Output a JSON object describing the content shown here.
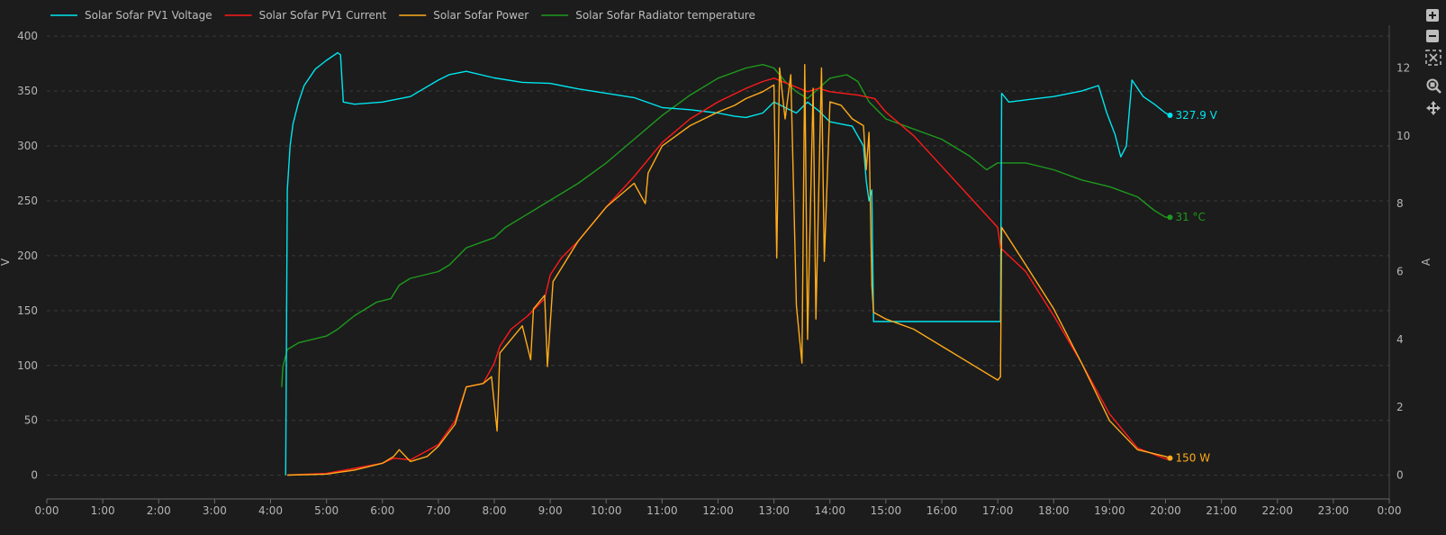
{
  "chart_data": {
    "type": "line",
    "title": "",
    "xlabel": "",
    "x_ticks": [
      "0:00",
      "1:00",
      "2:00",
      "3:00",
      "4:00",
      "5:00",
      "6:00",
      "7:00",
      "8:00",
      "9:00",
      "10:00",
      "11:00",
      "12:00",
      "13:00",
      "14:00",
      "15:00",
      "16:00",
      "17:00",
      "18:00",
      "19:00",
      "20:00",
      "21:00",
      "22:00",
      "23:00",
      "0:00"
    ],
    "xlim_hours": [
      0,
      24
    ],
    "y_left": {
      "label": "V",
      "lim": [
        -20,
        410
      ],
      "ticks": [
        "0",
        "50",
        "100",
        "150",
        "200",
        "250",
        "300",
        "350",
        "400"
      ],
      "tick_values": [
        0,
        50,
        100,
        150,
        200,
        250,
        300,
        350,
        400
      ]
    },
    "y_right": {
      "label": "A",
      "lim": [
        -0.65,
        13.26
      ],
      "ticks": [
        "0",
        "2",
        "4",
        "6",
        "8",
        "10",
        "12"
      ],
      "tick_values": [
        0,
        2,
        4,
        6,
        8,
        10,
        12
      ]
    },
    "grid": true,
    "legend_position": "top-left",
    "series": [
      {
        "name": "Solar Sofar PV1 Voltage",
        "color": "#00e5ee",
        "axis": "left",
        "end_label": "327.9 V",
        "points": [
          [
            4.27,
            0
          ],
          [
            4.3,
            260
          ],
          [
            4.35,
            300
          ],
          [
            4.4,
            320
          ],
          [
            4.5,
            340
          ],
          [
            4.6,
            355
          ],
          [
            4.8,
            370
          ],
          [
            5.0,
            378
          ],
          [
            5.2,
            385
          ],
          [
            5.25,
            383
          ],
          [
            5.3,
            340
          ],
          [
            5.5,
            338
          ],
          [
            6.0,
            340
          ],
          [
            6.5,
            345
          ],
          [
            7.0,
            360
          ],
          [
            7.2,
            365
          ],
          [
            7.5,
            368
          ],
          [
            8.0,
            362
          ],
          [
            8.5,
            358
          ],
          [
            9.0,
            357
          ],
          [
            9.5,
            352
          ],
          [
            10.0,
            348
          ],
          [
            10.5,
            344
          ],
          [
            11.0,
            335
          ],
          [
            11.5,
            333
          ],
          [
            12.0,
            330
          ],
          [
            12.3,
            327
          ],
          [
            12.5,
            326
          ],
          [
            12.8,
            330
          ],
          [
            13.0,
            340
          ],
          [
            13.2,
            335
          ],
          [
            13.4,
            330
          ],
          [
            13.6,
            340
          ],
          [
            13.8,
            332
          ],
          [
            14.0,
            322
          ],
          [
            14.2,
            320
          ],
          [
            14.4,
            318
          ],
          [
            14.6,
            300
          ],
          [
            14.65,
            268
          ],
          [
            14.7,
            250
          ],
          [
            14.75,
            260
          ],
          [
            14.78,
            140
          ],
          [
            15.0,
            140
          ],
          [
            16.0,
            140
          ],
          [
            17.0,
            140
          ],
          [
            17.05,
            140
          ],
          [
            17.07,
            348
          ],
          [
            17.2,
            340
          ],
          [
            17.5,
            342
          ],
          [
            18.0,
            345
          ],
          [
            18.5,
            350
          ],
          [
            18.8,
            355
          ],
          [
            18.95,
            330
          ],
          [
            19.1,
            310
          ],
          [
            19.2,
            290
          ],
          [
            19.3,
            300
          ],
          [
            19.4,
            360
          ],
          [
            19.6,
            345
          ],
          [
            19.8,
            338
          ],
          [
            20.0,
            330
          ],
          [
            20.08,
            327.9
          ]
        ]
      },
      {
        "name": "Solar Sofar PV1 Current",
        "color": "#ff1a1a",
        "axis": "right",
        "end_label": "",
        "points": [
          [
            4.3,
            0
          ],
          [
            5.0,
            0.05
          ],
          [
            5.5,
            0.2
          ],
          [
            6.0,
            0.35
          ],
          [
            6.2,
            0.5
          ],
          [
            6.5,
            0.45
          ],
          [
            7.0,
            0.9
          ],
          [
            7.3,
            1.6
          ],
          [
            7.5,
            2.6
          ],
          [
            7.8,
            2.7
          ],
          [
            8.0,
            3.3
          ],
          [
            8.1,
            3.8
          ],
          [
            8.3,
            4.3
          ],
          [
            8.6,
            4.7
          ],
          [
            8.9,
            5.2
          ],
          [
            9.0,
            5.9
          ],
          [
            9.2,
            6.4
          ],
          [
            9.5,
            6.9
          ],
          [
            10.0,
            7.9
          ],
          [
            10.5,
            8.8
          ],
          [
            11.0,
            9.8
          ],
          [
            11.5,
            10.5
          ],
          [
            12.0,
            11.0
          ],
          [
            12.5,
            11.4
          ],
          [
            12.8,
            11.6
          ],
          [
            13.0,
            11.7
          ],
          [
            13.3,
            11.5
          ],
          [
            13.6,
            11.3
          ],
          [
            13.8,
            11.4
          ],
          [
            14.0,
            11.3
          ],
          [
            14.5,
            11.2
          ],
          [
            14.8,
            11.1
          ],
          [
            15.0,
            10.7
          ],
          [
            15.5,
            10.0
          ],
          [
            16.0,
            9.1
          ],
          [
            16.5,
            8.2
          ],
          [
            17.0,
            7.3
          ],
          [
            17.05,
            6.7
          ],
          [
            17.5,
            6.0
          ],
          [
            18.0,
            4.7
          ],
          [
            18.5,
            3.3
          ],
          [
            19.0,
            1.8
          ],
          [
            19.5,
            0.8
          ],
          [
            20.0,
            0.48
          ],
          [
            20.08,
            0.46
          ]
        ]
      },
      {
        "name": "Solar Sofar Power",
        "color": "#ffab1a",
        "axis": "right",
        "end_label": "150 W",
        "points": [
          [
            4.3,
            0
          ],
          [
            5.0,
            0.03
          ],
          [
            5.5,
            0.15
          ],
          [
            6.0,
            0.35
          ],
          [
            6.2,
            0.55
          ],
          [
            6.3,
            0.75
          ],
          [
            6.5,
            0.4
          ],
          [
            6.8,
            0.55
          ],
          [
            7.0,
            0.85
          ],
          [
            7.3,
            1.5
          ],
          [
            7.5,
            2.6
          ],
          [
            7.8,
            2.7
          ],
          [
            7.95,
            2.9
          ],
          [
            8.05,
            1.3
          ],
          [
            8.1,
            3.6
          ],
          [
            8.5,
            4.4
          ],
          [
            8.65,
            3.4
          ],
          [
            8.7,
            4.9
          ],
          [
            8.9,
            5.3
          ],
          [
            8.95,
            3.2
          ],
          [
            9.05,
            5.7
          ],
          [
            9.5,
            6.9
          ],
          [
            10.0,
            7.9
          ],
          [
            10.5,
            8.6
          ],
          [
            10.7,
            8.0
          ],
          [
            10.75,
            8.9
          ],
          [
            11.0,
            9.7
          ],
          [
            11.5,
            10.3
          ],
          [
            12.0,
            10.7
          ],
          [
            12.3,
            10.9
          ],
          [
            12.5,
            11.1
          ],
          [
            12.8,
            11.3
          ],
          [
            13.0,
            11.5
          ],
          [
            13.05,
            6.4
          ],
          [
            13.1,
            12.0
          ],
          [
            13.2,
            10.5
          ],
          [
            13.3,
            11.8
          ],
          [
            13.4,
            5.0
          ],
          [
            13.5,
            3.3
          ],
          [
            13.55,
            12.1
          ],
          [
            13.6,
            4.0
          ],
          [
            13.7,
            11.4
          ],
          [
            13.75,
            4.6
          ],
          [
            13.85,
            12.0
          ],
          [
            13.9,
            6.3
          ],
          [
            14.0,
            11.0
          ],
          [
            14.2,
            10.9
          ],
          [
            14.4,
            10.5
          ],
          [
            14.6,
            10.3
          ],
          [
            14.65,
            9.0
          ],
          [
            14.7,
            10.1
          ],
          [
            14.75,
            5.6
          ],
          [
            14.78,
            4.8
          ],
          [
            15.0,
            4.6
          ],
          [
            15.5,
            4.3
          ],
          [
            16.0,
            3.8
          ],
          [
            16.5,
            3.3
          ],
          [
            17.0,
            2.8
          ],
          [
            17.05,
            2.9
          ],
          [
            17.07,
            7.3
          ],
          [
            17.5,
            6.2
          ],
          [
            18.0,
            4.9
          ],
          [
            18.5,
            3.3
          ],
          [
            19.0,
            1.6
          ],
          [
            19.5,
            0.75
          ],
          [
            20.0,
            0.55
          ],
          [
            20.08,
            0.5
          ]
        ]
      },
      {
        "name": "Solar Sofar Radiator temperature",
        "color": "#1e9a1e",
        "axis": "right",
        "end_label": "31 °C",
        "points": [
          [
            4.2,
            2.6
          ],
          [
            4.22,
            3.2
          ],
          [
            4.3,
            3.7
          ],
          [
            4.5,
            3.9
          ],
          [
            5.0,
            4.1
          ],
          [
            5.2,
            4.3
          ],
          [
            5.5,
            4.7
          ],
          [
            5.9,
            5.1
          ],
          [
            6.15,
            5.2
          ],
          [
            6.3,
            5.6
          ],
          [
            6.5,
            5.8
          ],
          [
            7.0,
            6.0
          ],
          [
            7.2,
            6.2
          ],
          [
            7.5,
            6.7
          ],
          [
            8.0,
            7.0
          ],
          [
            8.2,
            7.3
          ],
          [
            8.5,
            7.6
          ],
          [
            9.0,
            8.1
          ],
          [
            9.5,
            8.6
          ],
          [
            10.0,
            9.2
          ],
          [
            10.5,
            9.9
          ],
          [
            11.0,
            10.6
          ],
          [
            11.5,
            11.2
          ],
          [
            12.0,
            11.7
          ],
          [
            12.5,
            12.0
          ],
          [
            12.8,
            12.1
          ],
          [
            13.0,
            12.0
          ],
          [
            13.2,
            11.6
          ],
          [
            13.4,
            11.3
          ],
          [
            13.6,
            11.1
          ],
          [
            13.8,
            11.4
          ],
          [
            14.0,
            11.7
          ],
          [
            14.3,
            11.8
          ],
          [
            14.5,
            11.6
          ],
          [
            14.7,
            11.0
          ],
          [
            15.0,
            10.5
          ],
          [
            15.5,
            10.2
          ],
          [
            16.0,
            9.9
          ],
          [
            16.5,
            9.4
          ],
          [
            16.8,
            9.0
          ],
          [
            17.0,
            9.2
          ],
          [
            17.5,
            9.2
          ],
          [
            18.0,
            9.0
          ],
          [
            18.5,
            8.7
          ],
          [
            19.0,
            8.5
          ],
          [
            19.5,
            8.2
          ],
          [
            19.8,
            7.8
          ],
          [
            20.0,
            7.6
          ],
          [
            20.08,
            7.6
          ]
        ]
      }
    ]
  },
  "toolbar": {
    "items": [
      "zoom-in-icon",
      "zoom-out-icon",
      "fit-icon",
      "zoom-select-icon",
      "pan-icon"
    ]
  }
}
